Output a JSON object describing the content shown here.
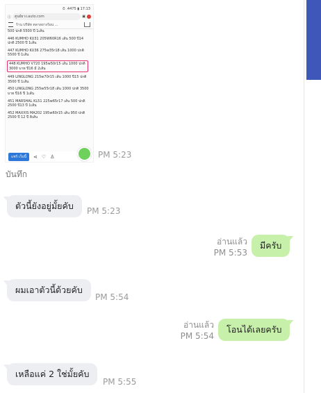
{
  "screenshot": {
    "status_text": "⏱ .4475 ▮ 17:13",
    "url": "ศูนย์ยาง.auto.com",
    "nav_title": "ร้าน  บริษัท ตลาดยางร้อน ...",
    "items": [
      "500 ปกติ 5500 ปี 1เส้น",
      "446 KUMHO KU31 205W60R16 เส้น 500 ปี14 ปกติ 2500 ปี 1เส้น",
      "447 KUMHO KU36 275w35r18 เส้น 1000 ปกติ 5500 ปี 1เส้น",
      "448 KUMHO V720 195w50r15 เส้น 1000 ปกติ 3000 บาท ปี16 มี 2เส้น",
      "449 LINGLONG 215w70r15 เส้น 1000 ปี15 ปกติ 3500 ปี 1เส้น",
      "450 LINGLONG 255w55r18 เส้น 1000 ปกติ 3500 บาท ปี16 ปี 1เส้น",
      "451 MARSHAL KL51 225w65r17 เส้น 500 ปกติ 2500 ปี13 ปี 1เส้น",
      "452 MAXXIS MA202 195w60r15 เส้น 950 ปกติ 2500 ปี 12 ปี 8เส้น"
    ],
    "share_button": "แชร์ เว็บนี้"
  },
  "note_label": "บันทึก",
  "messages": [
    {
      "time": "PM 5:23"
    },
    {
      "text": "ตัวนี้ยังอยู่มั้ยคับ",
      "time": "PM 5:23"
    },
    {
      "text": "มีครับ",
      "read": "อ่านแล้ว",
      "time": "PM 5:53"
    },
    {
      "text": "ผมเอาตัวนี้ด้วยคับ",
      "time": "PM 5:54"
    },
    {
      "text": "โอนได้เลยครับ",
      "read": "อ่านแล้ว",
      "time": "PM 5:54"
    },
    {
      "text": "เหลือแค่ 2 ใช่มั้ยคับ",
      "time": "PM 5:55"
    }
  ],
  "colors": {
    "incoming_bubble": "#eceef2",
    "outgoing_bubble": "#c7f0aa",
    "highlight": "#e0336c",
    "scroll_thumb": "#3e57b8"
  }
}
